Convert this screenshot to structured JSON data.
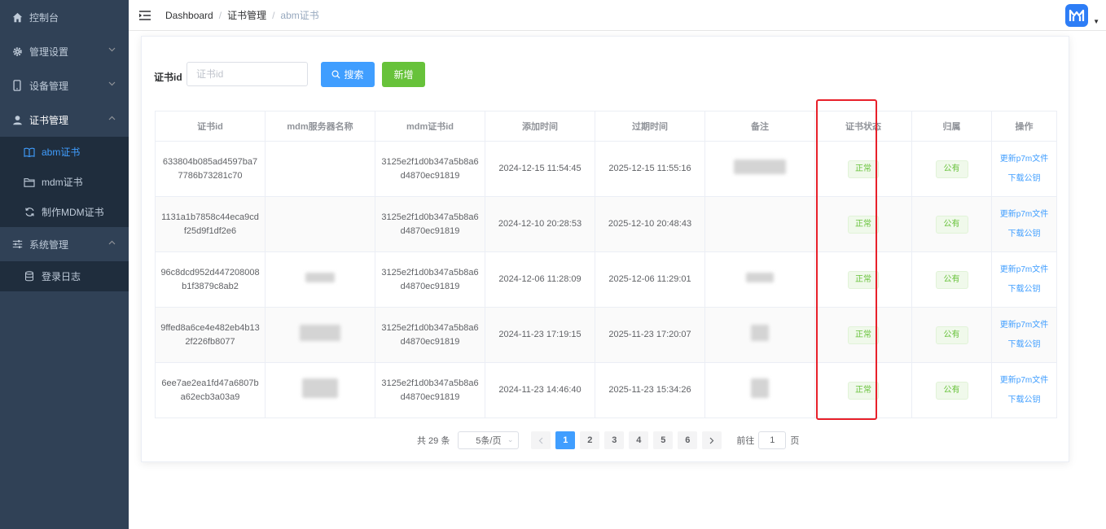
{
  "sidebar": {
    "items": [
      {
        "label": "控制台",
        "icon": "home-icon"
      },
      {
        "label": "管理设置",
        "icon": "gear-icon"
      },
      {
        "label": "设备管理",
        "icon": "phone-icon"
      },
      {
        "label": "证书管理",
        "icon": "user-icon"
      },
      {
        "label": "系统管理",
        "icon": "sliders-icon"
      }
    ],
    "cert_sub": [
      {
        "label": "abm证书",
        "icon": "book-icon"
      },
      {
        "label": "mdm证书",
        "icon": "folder-icon"
      },
      {
        "label": "制作MDM证书",
        "icon": "refresh-icon"
      }
    ],
    "system_sub": [
      {
        "label": "登录日志",
        "icon": "database-icon"
      }
    ]
  },
  "breadcrumb": [
    "Dashboard",
    "证书管理",
    "abm证书"
  ],
  "filter": {
    "label": "证书id",
    "placeholder": "证书id",
    "search_label": "搜索",
    "add_label": "新增"
  },
  "table": {
    "headers": [
      "证书id",
      "mdm服务器名称",
      "mdm证书id",
      "添加时间",
      "过期时间",
      "备注",
      "证书状态",
      "归属",
      "操作"
    ],
    "rows": [
      {
        "cert_id": "633804b085ad4597ba77786b73281c70",
        "mdm_cert_id": "3125e2f1d0b347a5b8a6d4870ec91819",
        "added": "2024-12-15 11:54:45",
        "expires": "2025-12-15 11:55:16",
        "status": "正常",
        "owner": "公有",
        "op1": "更新p7m文件",
        "op2": "下载公钥"
      },
      {
        "cert_id": "1131a1b7858c44eca9cdf25d9f1df2e6",
        "mdm_cert_id": "3125e2f1d0b347a5b8a6d4870ec91819",
        "added": "2024-12-10 20:28:53",
        "expires": "2025-12-10 20:48:43",
        "status": "正常",
        "owner": "公有",
        "op1": "更新p7m文件",
        "op2": "下载公钥"
      },
      {
        "cert_id": "96c8dcd952d447208008b1f3879c8ab2",
        "mdm_cert_id": "3125e2f1d0b347a5b8a6d4870ec91819",
        "added": "2024-12-06 11:28:09",
        "expires": "2025-12-06 11:29:01",
        "status": "正常",
        "owner": "公有",
        "op1": "更新p7m文件",
        "op2": "下载公钥"
      },
      {
        "cert_id": "9ffed8a6ce4e482eb4b132f226fb8077",
        "mdm_cert_id": "3125e2f1d0b347a5b8a6d4870ec91819",
        "added": "2024-11-23 17:19:15",
        "expires": "2025-11-23 17:20:07",
        "status": "正常",
        "owner": "公有",
        "op1": "更新p7m文件",
        "op2": "下载公钥"
      },
      {
        "cert_id": "6ee7ae2ea1fd47a6807ba62ecb3a03a9",
        "mdm_cert_id": "3125e2f1d0b347a5b8a6d4870ec91819",
        "added": "2024-11-23 14:46:40",
        "expires": "2025-11-23 15:34:26",
        "status": "正常",
        "owner": "公有",
        "op1": "更新p7m文件",
        "op2": "下载公钥"
      }
    ]
  },
  "pagination": {
    "total": "共 29 条",
    "page_size": "5条/页",
    "pages": [
      "1",
      "2",
      "3",
      "4",
      "5",
      "6"
    ],
    "current": "1",
    "goto_prefix": "前往",
    "goto_value": "1",
    "goto_suffix": "页"
  },
  "colors": {
    "sidebar_bg": "#304156",
    "primary": "#409eff",
    "success": "#67c23a",
    "highlight": "#e8202a"
  }
}
